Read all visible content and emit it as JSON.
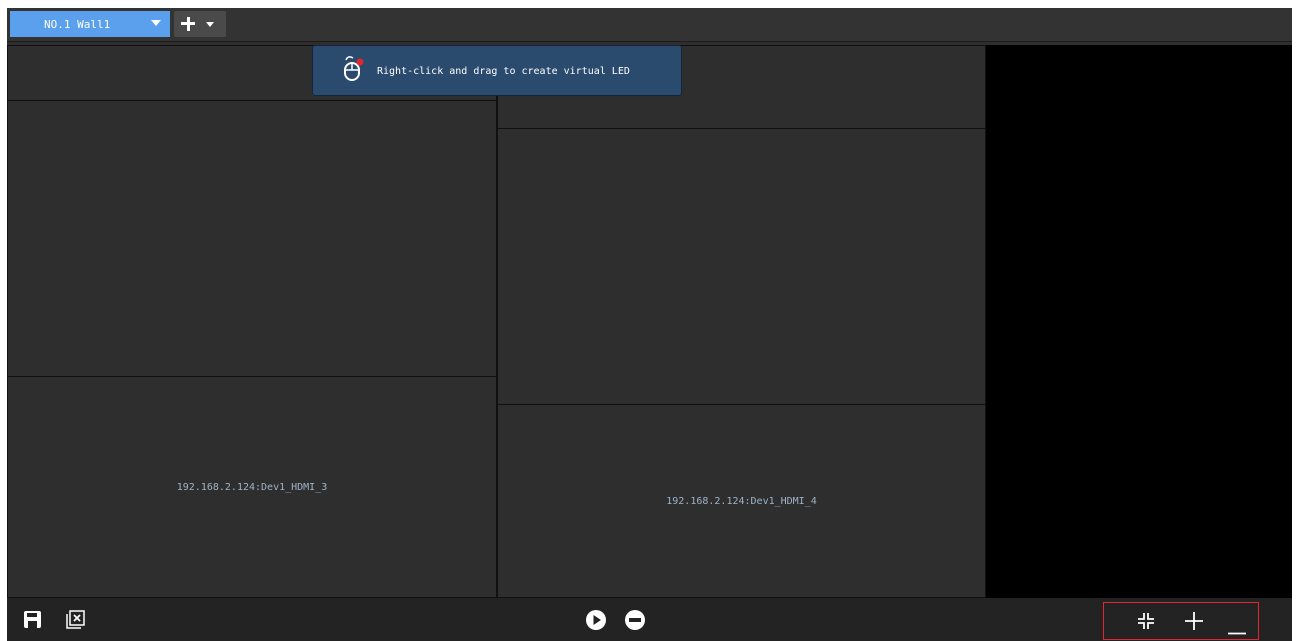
{
  "tabs": [
    {
      "label": "NO.1 Wall1"
    }
  ],
  "tooltip": {
    "text": "Right-click and drag to create virtual LED",
    "icon": "mouse-icon"
  },
  "windows": [
    {
      "name": "window-top-left",
      "label": ""
    },
    {
      "name": "window-top-right",
      "label": ""
    },
    {
      "name": "window-left-large",
      "label": ""
    },
    {
      "name": "window-right-large",
      "label": ""
    },
    {
      "name": "window-hdmi-3",
      "label": "192.168.2.124:Dev1_HDMI_3"
    },
    {
      "name": "window-hdmi-4",
      "label": "192.168.2.124:Dev1_HDMI_4"
    }
  ],
  "toolbar": {
    "left_icons": [
      "save-icon",
      "close-window-icon"
    ],
    "center_icons": [
      "play-icon",
      "stop-icon"
    ],
    "right_icons": [
      "fit-screen-icon",
      "zoom-in-icon",
      "zoom-out-icon"
    ]
  },
  "colors": {
    "tab_active": "#5aa0ec",
    "tooltip_bg": "#2a4a6e",
    "highlight_box": "#e0262f",
    "window_text": "#9fb3c7"
  }
}
